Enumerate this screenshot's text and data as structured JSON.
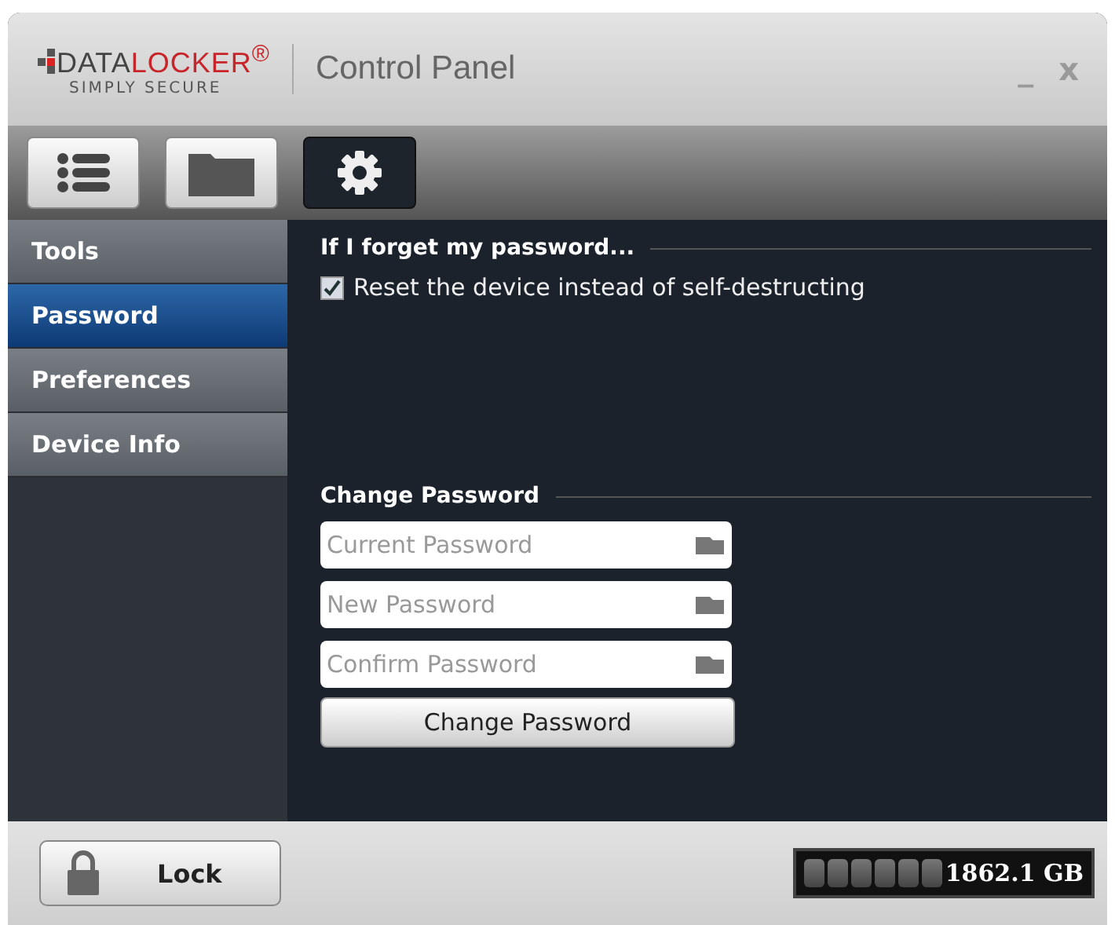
{
  "window": {
    "title": "Control Panel",
    "logo": {
      "word_1": "DATA",
      "word_2": "LOCKER$^{®}$",
      "tagline": "SIMPLY SECURE"
    },
    "controls": [
      "_",
      "x"
    ]
  },
  "toolbar": [
    {
      "kind": "list",
      "selected": false
    },
    {
      "kind": "folder",
      "selected": false
    },
    {
      "kind": "settings",
      "selected": true
    }
  ],
  "sidebar": {
    "items": [
      {
        "label": "Tools",
        "selected": false
      },
      {
        "label": "Password",
        "selected": true
      },
      {
        "label": "Preferences",
        "selected": false
      },
      {
        "label": "Device Info",
        "selected": false
      }
    ]
  },
  "forgot": {
    "heading": "If I forget my password...",
    "option": {
      "label": "Reset the device instead of self-destructing",
      "checked": true
    }
  },
  "change": {
    "heading": "Change Password",
    "fields": [
      {
        "placeholder": "Current Password"
      },
      {
        "placeholder": "New Password"
      },
      {
        "placeholder": "Confirm Password"
      }
    ],
    "button": "Change Password"
  },
  "footer": {
    "lock_button": "Lock",
    "capacity": "1862.1 GB"
  }
}
